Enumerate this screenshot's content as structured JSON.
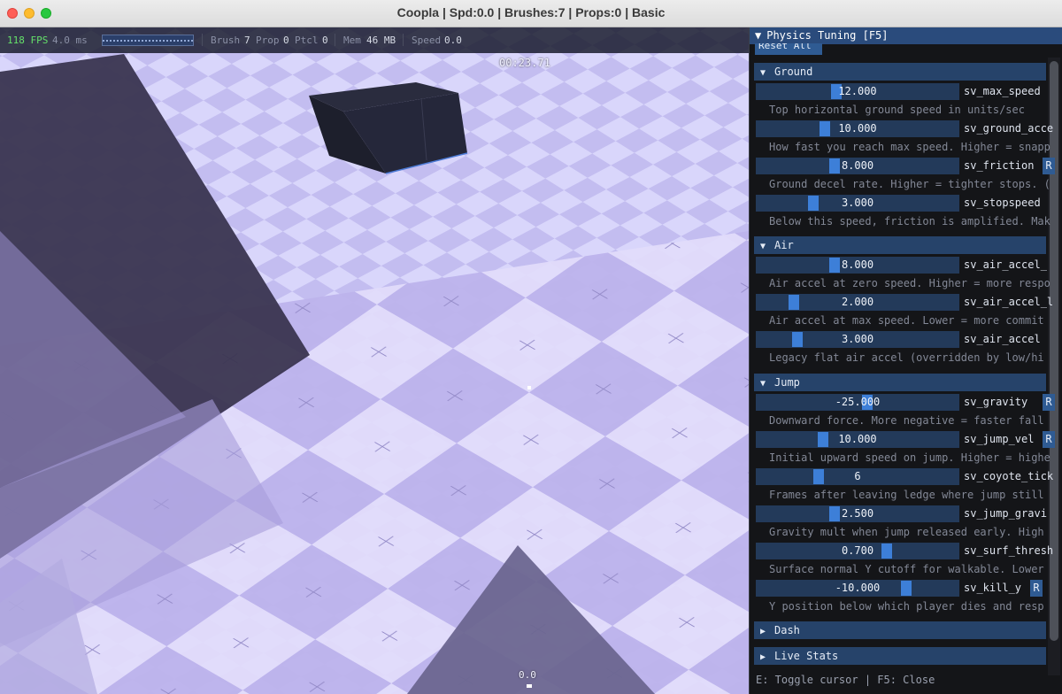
{
  "window": {
    "title": "Coopla | Spd:0.0 | Brushes:7 | Props:0 | Basic"
  },
  "hud": {
    "fps": "118 FPS",
    "frame_ms": "4.0 ms",
    "brush_label": "Brush",
    "brush_val": "7",
    "prop_label": "Prop",
    "prop_val": "0",
    "ptcl_label": "Ptcl",
    "ptcl_val": "0",
    "mem_label": "Mem",
    "mem_val": "46 MB",
    "speed_label": "Speed",
    "speed_val": "0.0"
  },
  "viewport": {
    "timer": "00:23.71",
    "speed_readout": "0.0"
  },
  "panel": {
    "title": "Physics Tuning [F5]",
    "reset_all": "Reset All",
    "footer": "E: Toggle cursor | F5: Close",
    "sections": {
      "ground": {
        "label": "Ground",
        "rows": [
          {
            "value": "12.000",
            "fill": 0.39,
            "name": "sv_max_speed",
            "desc": "Top horizontal ground speed in units/sec",
            "reset": ""
          },
          {
            "value": "10.000",
            "fill": 0.33,
            "name": "sv_ground_acce",
            "desc": "How fast you reach max speed. Higher = snapp",
            "reset": ""
          },
          {
            "value": "8.000",
            "fill": 0.38,
            "name": "sv_friction",
            "desc": "Ground decel rate. Higher = tighter stops. (",
            "reset": "R"
          },
          {
            "value": "3.000",
            "fill": 0.27,
            "name": "sv_stopspeed",
            "desc": "Below this speed, friction is amplified. Mak",
            "reset": ""
          }
        ]
      },
      "air": {
        "label": "Air",
        "rows": [
          {
            "value": "8.000",
            "fill": 0.38,
            "name": "sv_air_accel_",
            "desc": "Air accel at zero speed. Higher = more respo",
            "reset": ""
          },
          {
            "value": "2.000",
            "fill": 0.17,
            "name": "sv_air_accel_l",
            "desc": "Air accel at max speed. Lower = more commit",
            "reset": ""
          },
          {
            "value": "3.000",
            "fill": 0.19,
            "name": "sv_air_accel",
            "desc": "Legacy flat air accel (overridden by low/hi",
            "reset": ""
          }
        ]
      },
      "jump": {
        "label": "Jump",
        "rows": [
          {
            "value": "-25.000",
            "fill": 0.55,
            "name": "sv_gravity",
            "desc": "Downward force. More negative = faster fall",
            "reset": "R"
          },
          {
            "value": "10.000",
            "fill": 0.32,
            "name": "sv_jump_vel",
            "desc": "Initial upward speed on jump. Higher = highe",
            "reset": "R"
          },
          {
            "value": "6",
            "fill": 0.3,
            "name": "sv_coyote_tick",
            "desc": "Frames after leaving ledge where jump still",
            "reset": ""
          },
          {
            "value": "2.500",
            "fill": 0.38,
            "name": "sv_jump_gravi",
            "desc": "Gravity mult when jump released early. High",
            "reset": ""
          },
          {
            "value": "0.700",
            "fill": 0.65,
            "name": "sv_surf_thresh",
            "desc": "Surface normal Y cutoff for walkable. Lower",
            "reset": ""
          },
          {
            "value": "-10.000",
            "fill": 0.75,
            "name": "sv_kill_y",
            "desc": "Y position below which player dies and resp",
            "reset": "R"
          }
        ]
      },
      "dash": {
        "label": "Dash"
      },
      "live_stats": {
        "label": "Live Stats"
      }
    }
  }
}
